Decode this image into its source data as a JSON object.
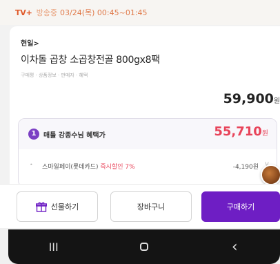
{
  "topbar": {
    "channel": "TV+",
    "broadcast_label": "방송중",
    "time": "03/24(목) 00:45~01:45"
  },
  "product": {
    "brand": "현일>",
    "title": "이차돌 곱창 소곱창전골 800gx8팩",
    "sub_info": "구매평 · 상품정보 · 판매자 · 혜택",
    "price": "59,900",
    "price_unit": "원",
    "price_suffix": "(",
    "colors": {
      "accent": "#6e1ec4",
      "sale": "#e8445a",
      "tv": "#e05a2b"
    }
  },
  "benefit": {
    "badge": "1",
    "label": "매틀 강종수님 혜택가",
    "price": "55,710",
    "price_unit": "원",
    "discount": {
      "label_prefix": "스마일페이(롯데카드) ",
      "label_highlight": "즉시할인 7%",
      "amount": "-4,190원",
      "chevron": "∨"
    }
  },
  "actions": {
    "gift_label": "선물하기",
    "cart_label": "장바구니",
    "buy_label": "구매하기"
  },
  "navbar": {
    "recent_icon": "recent-apps-icon",
    "home_icon": "home-icon",
    "back_icon": "back-icon",
    "recent": "III",
    "back": "‹"
  }
}
